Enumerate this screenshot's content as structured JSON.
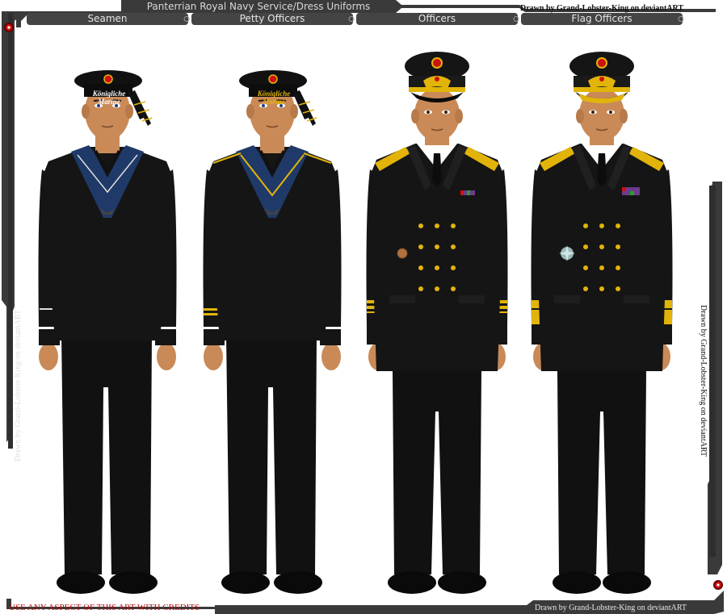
{
  "header": {
    "title": "Panterrian Royal Navy Service/Dress Uniforms",
    "credit": "Drawn by Grand-Lobster-King on deviantART"
  },
  "tabs": [
    {
      "label": "Seamen"
    },
    {
      "label": "Petty Officers"
    },
    {
      "label": "Officers"
    },
    {
      "label": "Flag Officers"
    }
  ],
  "side": {
    "left_credit": "Drawn by Grand-Lobster-King on deviantART",
    "right_credit": "Drawn by Grand-Lobster-King on deviantART"
  },
  "footer": {
    "notice": "USE ANY ASPECT OF THIS ART WITH CREDITS",
    "credit": "Drawn by Grand-Lobster-King on deviantART"
  },
  "figures": [
    {
      "cap_band": "Königliche Marine"
    },
    {
      "cap_band": "Königliche Marine"
    }
  ],
  "colors": {
    "frame": "#3a3a3a",
    "uniform": "#111111",
    "gold": "#e2b40a",
    "skin": "#c98a57",
    "collar_blue": "#1f3a68",
    "accent_red": "#cc1111"
  }
}
